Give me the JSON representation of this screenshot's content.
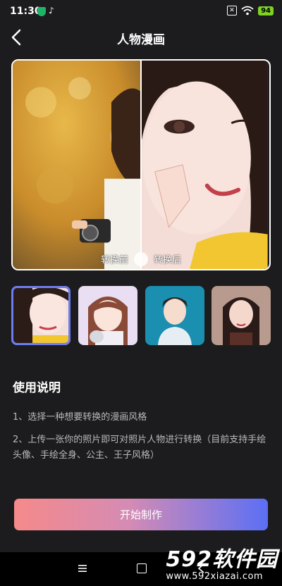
{
  "status_bar": {
    "time": "11:30",
    "battery": "94"
  },
  "header": {
    "title": "人物漫画"
  },
  "compare": {
    "before_label": "转换前",
    "after_label": "转换后"
  },
  "styles": [
    {
      "name": "style-1",
      "selected": true
    },
    {
      "name": "style-2",
      "selected": false
    },
    {
      "name": "style-3",
      "selected": false
    },
    {
      "name": "style-4",
      "selected": false
    }
  ],
  "instructions": {
    "title": "使用说明",
    "steps": [
      "1、选择一种想要转换的漫画风格",
      "2、上传一张你的照片即可对照片人物进行转换（目前支持手绘头像、手绘全身、公主、王子风格）"
    ]
  },
  "cta": {
    "label": "开始制作"
  },
  "watermark": {
    "brand": "592软件园",
    "url": "www.592xiazai.com"
  },
  "colors": {
    "accent_start": "#f58a8a",
    "accent_end": "#5b6ff5",
    "background": "#1c1c1e"
  }
}
